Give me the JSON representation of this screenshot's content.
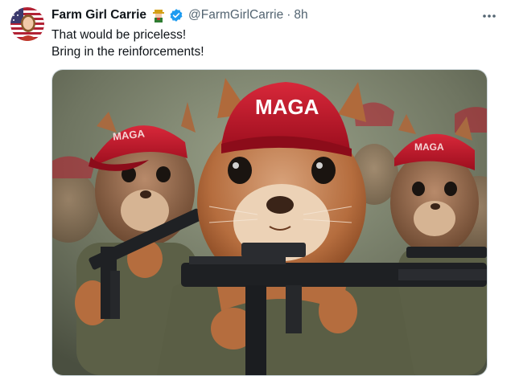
{
  "tweet": {
    "display_name": "Farm Girl Carrie",
    "name_emoji": "farmer-emoji",
    "verified_icon": "verified-badge-icon",
    "handle": "@FarmGirlCarrie",
    "separator": "·",
    "time": "8h",
    "text_lines": [
      "That would be priceless!",
      "Bring in the reinforcements!"
    ],
    "more_icon": "more-dots-icon"
  },
  "media": {
    "description_hidden": true,
    "cap_text": "MAGA"
  },
  "colors": {
    "verified": "#1d9bf0",
    "text": "#0f1419",
    "muted": "#536471",
    "cap_red": "#c8102e"
  }
}
